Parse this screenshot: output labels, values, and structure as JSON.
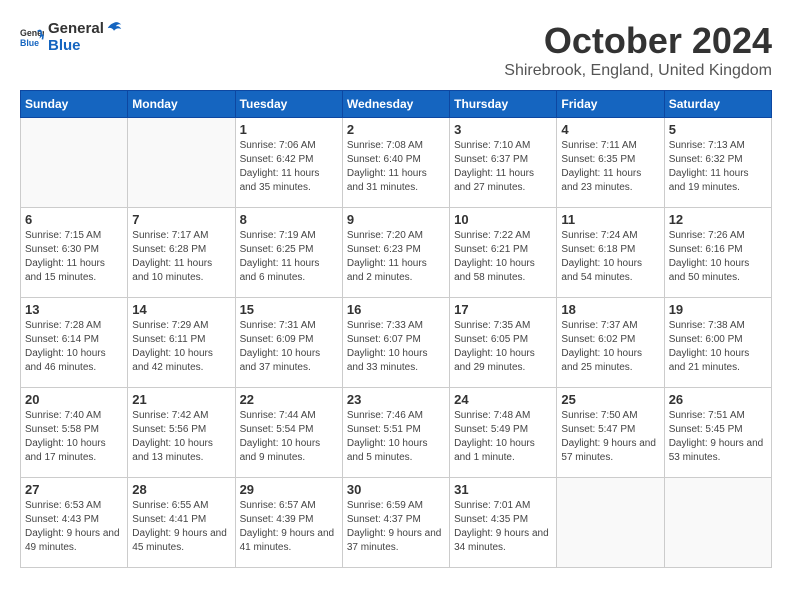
{
  "header": {
    "logo_general": "General",
    "logo_blue": "Blue",
    "month_title": "October 2024",
    "location": "Shirebrook, England, United Kingdom"
  },
  "weekdays": [
    "Sunday",
    "Monday",
    "Tuesday",
    "Wednesday",
    "Thursday",
    "Friday",
    "Saturday"
  ],
  "days": {
    "1": {
      "sunrise": "7:06 AM",
      "sunset": "6:42 PM",
      "daylight": "11 hours and 35 minutes."
    },
    "2": {
      "sunrise": "7:08 AM",
      "sunset": "6:40 PM",
      "daylight": "11 hours and 31 minutes."
    },
    "3": {
      "sunrise": "7:10 AM",
      "sunset": "6:37 PM",
      "daylight": "11 hours and 27 minutes."
    },
    "4": {
      "sunrise": "7:11 AM",
      "sunset": "6:35 PM",
      "daylight": "11 hours and 23 minutes."
    },
    "5": {
      "sunrise": "7:13 AM",
      "sunset": "6:32 PM",
      "daylight": "11 hours and 19 minutes."
    },
    "6": {
      "sunrise": "7:15 AM",
      "sunset": "6:30 PM",
      "daylight": "11 hours and 15 minutes."
    },
    "7": {
      "sunrise": "7:17 AM",
      "sunset": "6:28 PM",
      "daylight": "11 hours and 10 minutes."
    },
    "8": {
      "sunrise": "7:19 AM",
      "sunset": "6:25 PM",
      "daylight": "11 hours and 6 minutes."
    },
    "9": {
      "sunrise": "7:20 AM",
      "sunset": "6:23 PM",
      "daylight": "11 hours and 2 minutes."
    },
    "10": {
      "sunrise": "7:22 AM",
      "sunset": "6:21 PM",
      "daylight": "10 hours and 58 minutes."
    },
    "11": {
      "sunrise": "7:24 AM",
      "sunset": "6:18 PM",
      "daylight": "10 hours and 54 minutes."
    },
    "12": {
      "sunrise": "7:26 AM",
      "sunset": "6:16 PM",
      "daylight": "10 hours and 50 minutes."
    },
    "13": {
      "sunrise": "7:28 AM",
      "sunset": "6:14 PM",
      "daylight": "10 hours and 46 minutes."
    },
    "14": {
      "sunrise": "7:29 AM",
      "sunset": "6:11 PM",
      "daylight": "10 hours and 42 minutes."
    },
    "15": {
      "sunrise": "7:31 AM",
      "sunset": "6:09 PM",
      "daylight": "10 hours and 37 minutes."
    },
    "16": {
      "sunrise": "7:33 AM",
      "sunset": "6:07 PM",
      "daylight": "10 hours and 33 minutes."
    },
    "17": {
      "sunrise": "7:35 AM",
      "sunset": "6:05 PM",
      "daylight": "10 hours and 29 minutes."
    },
    "18": {
      "sunrise": "7:37 AM",
      "sunset": "6:02 PM",
      "daylight": "10 hours and 25 minutes."
    },
    "19": {
      "sunrise": "7:38 AM",
      "sunset": "6:00 PM",
      "daylight": "10 hours and 21 minutes."
    },
    "20": {
      "sunrise": "7:40 AM",
      "sunset": "5:58 PM",
      "daylight": "10 hours and 17 minutes."
    },
    "21": {
      "sunrise": "7:42 AM",
      "sunset": "5:56 PM",
      "daylight": "10 hours and 13 minutes."
    },
    "22": {
      "sunrise": "7:44 AM",
      "sunset": "5:54 PM",
      "daylight": "10 hours and 9 minutes."
    },
    "23": {
      "sunrise": "7:46 AM",
      "sunset": "5:51 PM",
      "daylight": "10 hours and 5 minutes."
    },
    "24": {
      "sunrise": "7:48 AM",
      "sunset": "5:49 PM",
      "daylight": "10 hours and 1 minute."
    },
    "25": {
      "sunrise": "7:50 AM",
      "sunset": "5:47 PM",
      "daylight": "9 hours and 57 minutes."
    },
    "26": {
      "sunrise": "7:51 AM",
      "sunset": "5:45 PM",
      "daylight": "9 hours and 53 minutes."
    },
    "27": {
      "sunrise": "6:53 AM",
      "sunset": "4:43 PM",
      "daylight": "9 hours and 49 minutes."
    },
    "28": {
      "sunrise": "6:55 AM",
      "sunset": "4:41 PM",
      "daylight": "9 hours and 45 minutes."
    },
    "29": {
      "sunrise": "6:57 AM",
      "sunset": "4:39 PM",
      "daylight": "9 hours and 41 minutes."
    },
    "30": {
      "sunrise": "6:59 AM",
      "sunset": "4:37 PM",
      "daylight": "9 hours and 37 minutes."
    },
    "31": {
      "sunrise": "7:01 AM",
      "sunset": "4:35 PM",
      "daylight": "9 hours and 34 minutes."
    }
  }
}
